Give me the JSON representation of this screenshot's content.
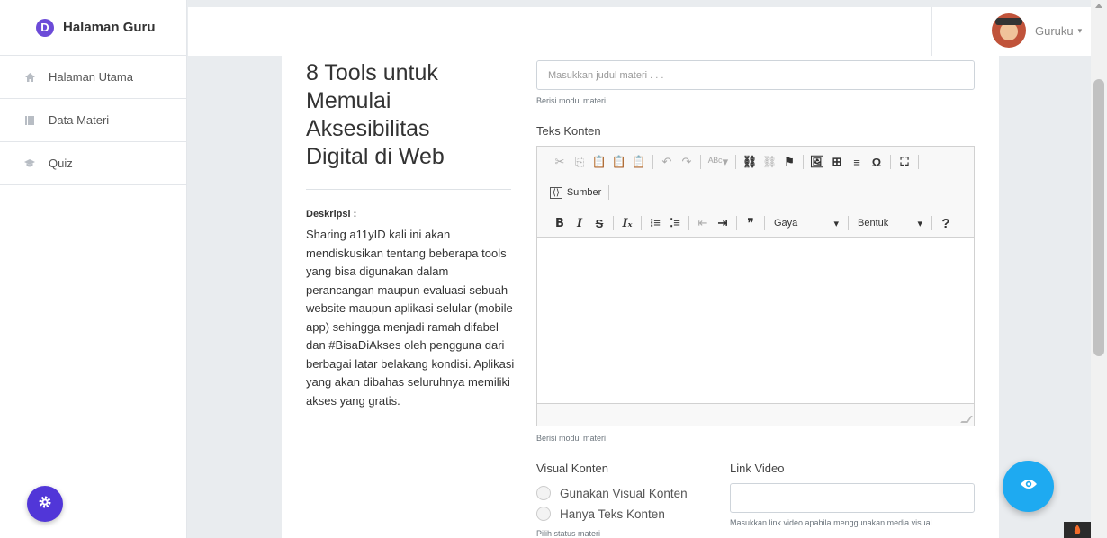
{
  "sidebar": {
    "brand_logo": "D",
    "brand": "Halaman Guru",
    "items": [
      {
        "label": "Halaman Utama",
        "icon": "home-icon"
      },
      {
        "label": "Data Materi",
        "icon": "book-icon"
      },
      {
        "label": "Quiz",
        "icon": "graduation-cap-icon"
      }
    ],
    "settings_icon": "gear-icon"
  },
  "header": {
    "username": "Guruku",
    "caret": "▾"
  },
  "preview": {
    "title": "8 Tools untuk Memulai Aksesibilitas Digital di Web",
    "desc_label": "Deskripsi :",
    "desc_text": "Sharing a11yID kali ini akan mendiskusikan tentang beberapa tools yang bisa digunakan dalam perancangan maupun evaluasi sebuah website maupun aplikasi selular (mobile app) sehingga menjadi ramah difabel dan #BisaDiAkses oleh pengguna dari berbagai latar belakang kondisi. Aplikasi yang akan dibahas seluruhnya memiliki akses yang gratis."
  },
  "form": {
    "title_placeholder": "Masukkan judul materi . . .",
    "title_help": "Berisi modul materi",
    "content_label": "Teks Konten",
    "content_help": "Berisi modul materi",
    "editor": {
      "source_label": "Sumber",
      "style_label": "Gaya",
      "format_label": "Bentuk",
      "help_symbol": "?"
    },
    "visual_label": "Visual Konten",
    "visual_options": [
      "Gunakan Visual Konten",
      "Hanya Teks Konten"
    ],
    "visual_help": "Pilih status materi",
    "video_label": "Link Video",
    "video_value": "",
    "video_help": "Masukkan link video apabila menggunakan media visual"
  },
  "colors": {
    "brand": "#6c4bd8",
    "settings_fab": "#5136d8",
    "preview_fab": "#1eaaf1"
  }
}
